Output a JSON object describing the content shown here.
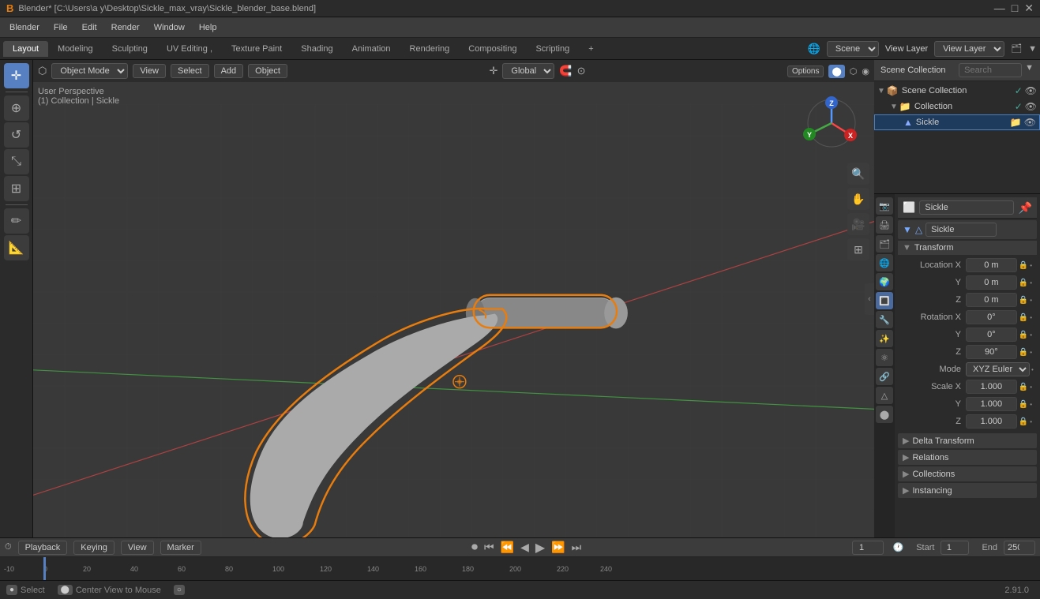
{
  "titlebar": {
    "logo": "B",
    "title": "Blender* [C:\\Users\\a y\\Desktop\\Sickle_max_vray\\Sickle_blender_base.blend]",
    "controls": [
      "—",
      "□",
      "✕"
    ]
  },
  "menubar": {
    "items": [
      "Blender",
      "File",
      "Edit",
      "Render",
      "Window",
      "Help"
    ]
  },
  "workspaces": {
    "tabs": [
      "Layout",
      "Modeling",
      "Sculpting",
      "UV Editing ,",
      "Texture Paint",
      "Shading",
      "Animation",
      "Rendering",
      "Compositing",
      "Scripting",
      "+"
    ],
    "active": "Layout",
    "scene": "Scene",
    "view_layer": "View Layer"
  },
  "viewport": {
    "mode": "Object Mode",
    "view_label": "View",
    "select_label": "Select",
    "add_label": "Add",
    "object_label": "Object",
    "global_label": "Global",
    "info_line1": "User Perspective",
    "info_line2": "(1) Collection | Sickle",
    "options_label": "Options"
  },
  "outliner": {
    "title": "Scene Collection",
    "items": [
      {
        "label": "Scene Collection",
        "level": 0,
        "icon": "📦",
        "has_arrow": true,
        "selected": false
      },
      {
        "label": "Collection",
        "level": 1,
        "icon": "📁",
        "has_arrow": true,
        "selected": false,
        "vis": true
      },
      {
        "label": "Sickle",
        "level": 2,
        "icon": "▲",
        "has_arrow": false,
        "selected": true,
        "vis": true
      }
    ]
  },
  "properties": {
    "object_name": "Sickle",
    "mesh_name": "Sickle",
    "transform": {
      "label": "Transform",
      "location": {
        "x": "0 m",
        "y": "0 m",
        "z": "0 m"
      },
      "rotation": {
        "x": "0°",
        "y": "0°",
        "z": "90°"
      },
      "mode": "XYZ Euler",
      "scale": {
        "x": "1.000",
        "y": "1.000",
        "z": "1.000"
      }
    },
    "sections": [
      {
        "label": "Delta Transform",
        "collapsed": true
      },
      {
        "label": "Relations",
        "collapsed": true
      },
      {
        "label": "Collections",
        "collapsed": true
      },
      {
        "label": "Instancing",
        "collapsed": true
      }
    ]
  },
  "timeline": {
    "frame": "1",
    "start": "1",
    "end": "250",
    "start_label": "Start",
    "end_label": "End",
    "controls": [
      "playback",
      "keying",
      "view",
      "marker"
    ],
    "playback_label": "Playback",
    "keying_label": "Keying",
    "view_label": "View",
    "marker_label": "Marker"
  },
  "statusbar": {
    "select": "Select",
    "center_view": "Center View to Mouse",
    "version": "2.91.0"
  },
  "icons": {
    "cursor": "✛",
    "move": "⊕",
    "rotate": "↺",
    "scale": "⤡",
    "transform": "⊞",
    "annotate": "✏",
    "measure": "📐",
    "search": "🔍",
    "hand": "✋",
    "camera": "🎥",
    "grid": "⊞"
  }
}
